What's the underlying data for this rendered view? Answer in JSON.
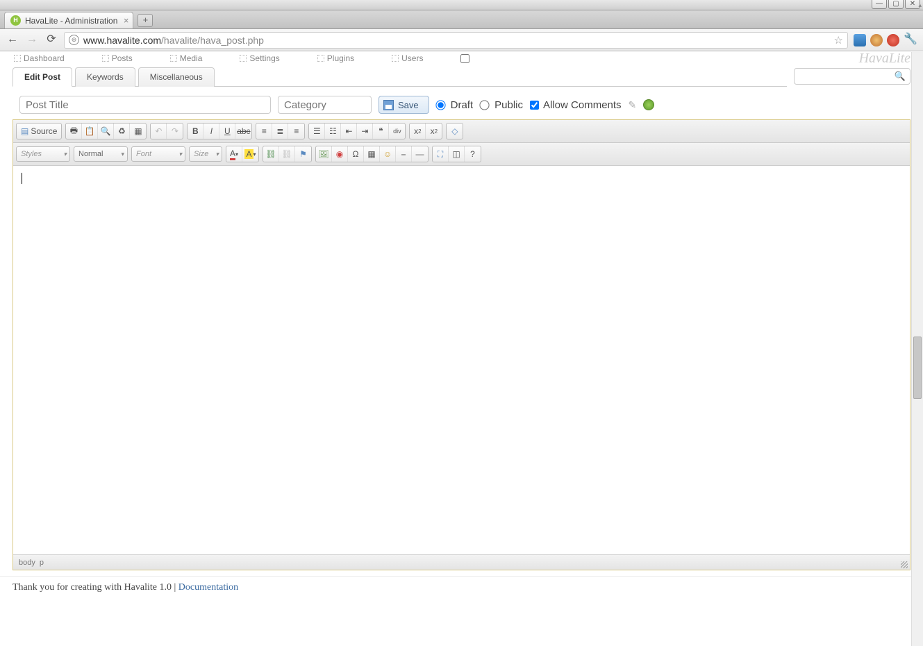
{
  "window": {
    "title": "HavaLite - Administration"
  },
  "browser": {
    "url_host": "www.havalite.com",
    "url_path": "/havalite/hava_post.php",
    "tab_title": "HavaLite - Administration"
  },
  "admin_nav": {
    "items": [
      "Dashboard",
      "Posts",
      "Media",
      "Settings",
      "Plugins",
      "Users"
    ],
    "brand": "HavaLite"
  },
  "page_tabs": {
    "items": [
      {
        "label": "Edit Post",
        "active": true
      },
      {
        "label": "Keywords",
        "active": false
      },
      {
        "label": "Miscellaneous",
        "active": false
      }
    ]
  },
  "form": {
    "title_placeholder": "Post Title",
    "category_placeholder": "Category",
    "save_label": "Save",
    "draft_label": "Draft",
    "public_label": "Public",
    "allow_comments_label": "Allow Comments",
    "draft_checked": true,
    "public_checked": false,
    "allow_comments_checked": true
  },
  "editor": {
    "source_label": "Source",
    "styles_label": "Styles",
    "format_label": "Normal",
    "font_label": "Font",
    "size_label": "Size",
    "status_path": [
      "body",
      "p"
    ]
  },
  "footer": {
    "text_prefix": "Thank you for creating with Havalite 1.0 | ",
    "doc_label": "Documentation"
  }
}
